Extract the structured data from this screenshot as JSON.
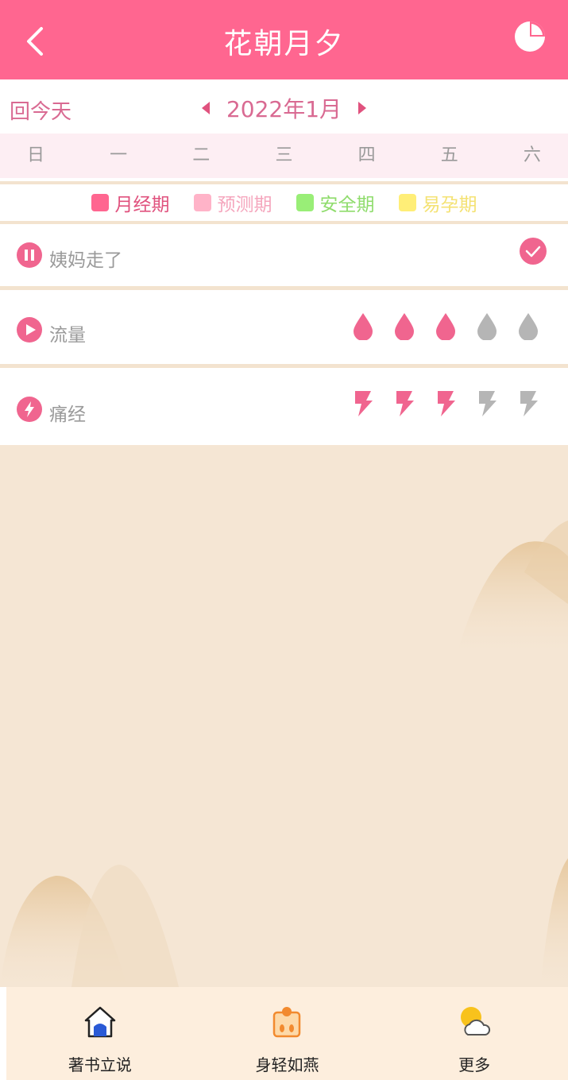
{
  "header": {
    "title": "花朝月夕",
    "back_icon": "chevron-left-icon",
    "stats_icon": "pie-chart-icon",
    "color": "#ff6690"
  },
  "month_bar": {
    "today_label": "回今天",
    "month_label": "2022年1月",
    "prev_icon": "triangle-left-icon",
    "next_icon": "triangle-right-icon"
  },
  "weekdays": [
    "日",
    "一",
    "二",
    "三",
    "四",
    "五",
    "六"
  ],
  "legend": [
    {
      "label": "月经期",
      "color": "#ff6690"
    },
    {
      "label": "预测期",
      "color": "#ffb3c8"
    },
    {
      "label": "安全期",
      "color": "#99ee77"
    },
    {
      "label": "易孕期",
      "color": "#ffee77"
    }
  ],
  "records": {
    "period_end": {
      "label": "姨妈走了",
      "icon": "pause-icon",
      "checked": true
    },
    "flow": {
      "label": "流量",
      "icon": "play-icon",
      "level": 3,
      "max": 5
    },
    "pain": {
      "label": "痛经",
      "icon": "lightning-icon",
      "level": 3,
      "max": 5
    }
  },
  "tabs": [
    {
      "label": "著书立说",
      "icon": "house-icon"
    },
    {
      "label": "身轻如燕",
      "icon": "scale-icon"
    },
    {
      "label": "更多",
      "icon": "weather-icon"
    }
  ]
}
